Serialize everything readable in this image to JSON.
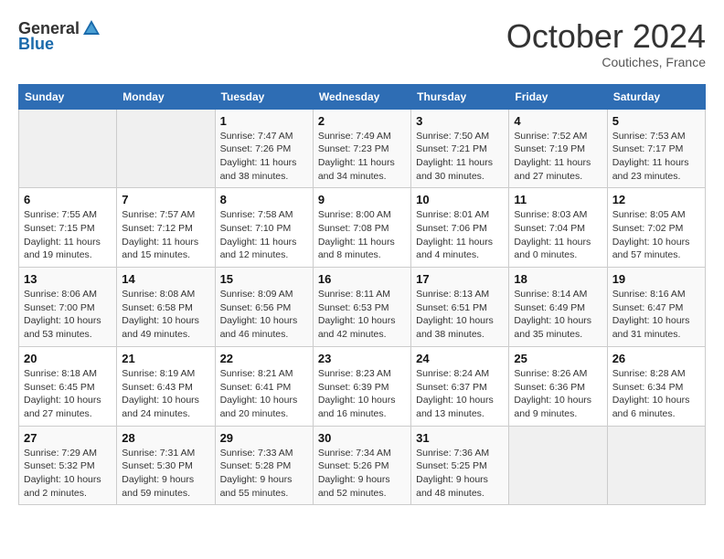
{
  "header": {
    "logo_general": "General",
    "logo_blue": "Blue",
    "month": "October 2024",
    "location": "Coutiches, France"
  },
  "weekdays": [
    "Sunday",
    "Monday",
    "Tuesday",
    "Wednesday",
    "Thursday",
    "Friday",
    "Saturday"
  ],
  "weeks": [
    [
      {
        "day": "",
        "sunrise": "",
        "sunset": "",
        "daylight": ""
      },
      {
        "day": "",
        "sunrise": "",
        "sunset": "",
        "daylight": ""
      },
      {
        "day": "1",
        "sunrise": "Sunrise: 7:47 AM",
        "sunset": "Sunset: 7:26 PM",
        "daylight": "Daylight: 11 hours and 38 minutes."
      },
      {
        "day": "2",
        "sunrise": "Sunrise: 7:49 AM",
        "sunset": "Sunset: 7:23 PM",
        "daylight": "Daylight: 11 hours and 34 minutes."
      },
      {
        "day": "3",
        "sunrise": "Sunrise: 7:50 AM",
        "sunset": "Sunset: 7:21 PM",
        "daylight": "Daylight: 11 hours and 30 minutes."
      },
      {
        "day": "4",
        "sunrise": "Sunrise: 7:52 AM",
        "sunset": "Sunset: 7:19 PM",
        "daylight": "Daylight: 11 hours and 27 minutes."
      },
      {
        "day": "5",
        "sunrise": "Sunrise: 7:53 AM",
        "sunset": "Sunset: 7:17 PM",
        "daylight": "Daylight: 11 hours and 23 minutes."
      }
    ],
    [
      {
        "day": "6",
        "sunrise": "Sunrise: 7:55 AM",
        "sunset": "Sunset: 7:15 PM",
        "daylight": "Daylight: 11 hours and 19 minutes."
      },
      {
        "day": "7",
        "sunrise": "Sunrise: 7:57 AM",
        "sunset": "Sunset: 7:12 PM",
        "daylight": "Daylight: 11 hours and 15 minutes."
      },
      {
        "day": "8",
        "sunrise": "Sunrise: 7:58 AM",
        "sunset": "Sunset: 7:10 PM",
        "daylight": "Daylight: 11 hours and 12 minutes."
      },
      {
        "day": "9",
        "sunrise": "Sunrise: 8:00 AM",
        "sunset": "Sunset: 7:08 PM",
        "daylight": "Daylight: 11 hours and 8 minutes."
      },
      {
        "day": "10",
        "sunrise": "Sunrise: 8:01 AM",
        "sunset": "Sunset: 7:06 PM",
        "daylight": "Daylight: 11 hours and 4 minutes."
      },
      {
        "day": "11",
        "sunrise": "Sunrise: 8:03 AM",
        "sunset": "Sunset: 7:04 PM",
        "daylight": "Daylight: 11 hours and 0 minutes."
      },
      {
        "day": "12",
        "sunrise": "Sunrise: 8:05 AM",
        "sunset": "Sunset: 7:02 PM",
        "daylight": "Daylight: 10 hours and 57 minutes."
      }
    ],
    [
      {
        "day": "13",
        "sunrise": "Sunrise: 8:06 AM",
        "sunset": "Sunset: 7:00 PM",
        "daylight": "Daylight: 10 hours and 53 minutes."
      },
      {
        "day": "14",
        "sunrise": "Sunrise: 8:08 AM",
        "sunset": "Sunset: 6:58 PM",
        "daylight": "Daylight: 10 hours and 49 minutes."
      },
      {
        "day": "15",
        "sunrise": "Sunrise: 8:09 AM",
        "sunset": "Sunset: 6:56 PM",
        "daylight": "Daylight: 10 hours and 46 minutes."
      },
      {
        "day": "16",
        "sunrise": "Sunrise: 8:11 AM",
        "sunset": "Sunset: 6:53 PM",
        "daylight": "Daylight: 10 hours and 42 minutes."
      },
      {
        "day": "17",
        "sunrise": "Sunrise: 8:13 AM",
        "sunset": "Sunset: 6:51 PM",
        "daylight": "Daylight: 10 hours and 38 minutes."
      },
      {
        "day": "18",
        "sunrise": "Sunrise: 8:14 AM",
        "sunset": "Sunset: 6:49 PM",
        "daylight": "Daylight: 10 hours and 35 minutes."
      },
      {
        "day": "19",
        "sunrise": "Sunrise: 8:16 AM",
        "sunset": "Sunset: 6:47 PM",
        "daylight": "Daylight: 10 hours and 31 minutes."
      }
    ],
    [
      {
        "day": "20",
        "sunrise": "Sunrise: 8:18 AM",
        "sunset": "Sunset: 6:45 PM",
        "daylight": "Daylight: 10 hours and 27 minutes."
      },
      {
        "day": "21",
        "sunrise": "Sunrise: 8:19 AM",
        "sunset": "Sunset: 6:43 PM",
        "daylight": "Daylight: 10 hours and 24 minutes."
      },
      {
        "day": "22",
        "sunrise": "Sunrise: 8:21 AM",
        "sunset": "Sunset: 6:41 PM",
        "daylight": "Daylight: 10 hours and 20 minutes."
      },
      {
        "day": "23",
        "sunrise": "Sunrise: 8:23 AM",
        "sunset": "Sunset: 6:39 PM",
        "daylight": "Daylight: 10 hours and 16 minutes."
      },
      {
        "day": "24",
        "sunrise": "Sunrise: 8:24 AM",
        "sunset": "Sunset: 6:37 PM",
        "daylight": "Daylight: 10 hours and 13 minutes."
      },
      {
        "day": "25",
        "sunrise": "Sunrise: 8:26 AM",
        "sunset": "Sunset: 6:36 PM",
        "daylight": "Daylight: 10 hours and 9 minutes."
      },
      {
        "day": "26",
        "sunrise": "Sunrise: 8:28 AM",
        "sunset": "Sunset: 6:34 PM",
        "daylight": "Daylight: 10 hours and 6 minutes."
      }
    ],
    [
      {
        "day": "27",
        "sunrise": "Sunrise: 7:29 AM",
        "sunset": "Sunset: 5:32 PM",
        "daylight": "Daylight: 10 hours and 2 minutes."
      },
      {
        "day": "28",
        "sunrise": "Sunrise: 7:31 AM",
        "sunset": "Sunset: 5:30 PM",
        "daylight": "Daylight: 9 hours and 59 minutes."
      },
      {
        "day": "29",
        "sunrise": "Sunrise: 7:33 AM",
        "sunset": "Sunset: 5:28 PM",
        "daylight": "Daylight: 9 hours and 55 minutes."
      },
      {
        "day": "30",
        "sunrise": "Sunrise: 7:34 AM",
        "sunset": "Sunset: 5:26 PM",
        "daylight": "Daylight: 9 hours and 52 minutes."
      },
      {
        "day": "31",
        "sunrise": "Sunrise: 7:36 AM",
        "sunset": "Sunset: 5:25 PM",
        "daylight": "Daylight: 9 hours and 48 minutes."
      },
      {
        "day": "",
        "sunrise": "",
        "sunset": "",
        "daylight": ""
      },
      {
        "day": "",
        "sunrise": "",
        "sunset": "",
        "daylight": ""
      }
    ]
  ]
}
